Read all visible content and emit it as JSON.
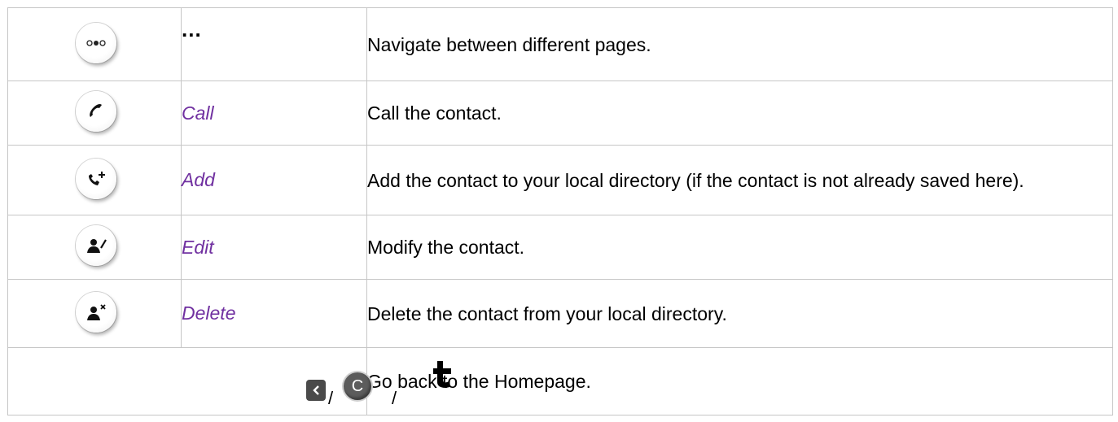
{
  "rows": [
    {
      "icon": "more-dots-icon",
      "label": "...",
      "description": "Navigate between different pages."
    },
    {
      "icon": "phone-handset-icon",
      "label": "Call",
      "description": "Call the contact."
    },
    {
      "icon": "add-call-icon",
      "label": "Add",
      "description": "Add the contact to your local directory (if the contact is not already saved here)."
    },
    {
      "icon": "edit-contact-icon",
      "label": "Edit",
      "description": "Modify the contact."
    },
    {
      "icon": "delete-contact-icon",
      "label": "Delete",
      "description": "Delete the contact from your local directory."
    }
  ],
  "home_row": {
    "separator": "/",
    "c_key_letter": "C",
    "icons": [
      "back-key-icon",
      "c-key-icon",
      "home-key-icon"
    ],
    "description": "Go back to the Homepage."
  },
  "colors": {
    "label_accent": "#7030a0",
    "border": "#c6c6c6"
  }
}
